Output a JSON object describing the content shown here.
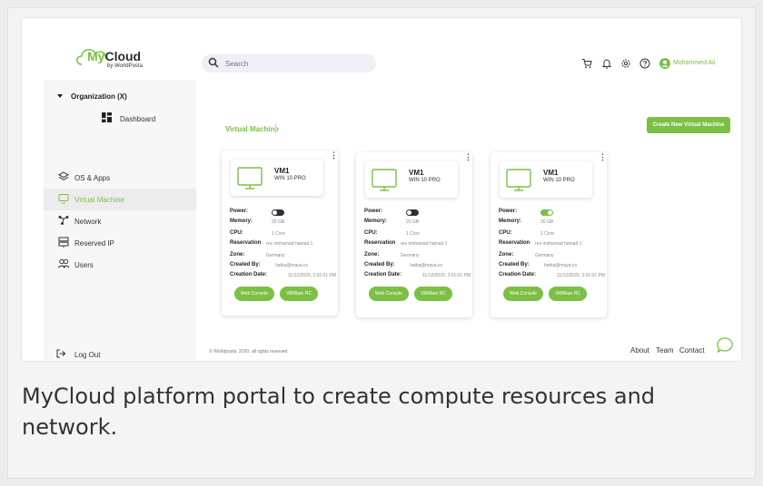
{
  "app": {
    "logo_my": "My",
    "logo_cloud": "Cloud",
    "logo_sub": "by WorldPosta"
  },
  "search": {
    "placeholder": "Search"
  },
  "header": {
    "user_name": "Mohammed Ali",
    "icons": [
      "cart-icon",
      "bell-icon",
      "gear-icon",
      "help-icon",
      "user-icon"
    ]
  },
  "sidebar": {
    "org": "Organization (X)",
    "dashboard": "Dashboard",
    "items": [
      {
        "label": "OS & Apps",
        "icon": "layers-icon"
      },
      {
        "label": "Virtual Machine",
        "icon": "monitor-icon",
        "active": true
      },
      {
        "label": "Network",
        "icon": "network-icon"
      },
      {
        "label": "Reserved IP",
        "icon": "server-icon"
      },
      {
        "label": "Users",
        "icon": "users-icon"
      }
    ],
    "logout": "Log Out"
  },
  "main": {
    "title": "Virtual Machine",
    "create_button": "Create New Virtual Machine",
    "field_labels": [
      "Power:",
      "Memory:",
      "CPU:",
      "Reservation",
      "Zone:",
      "Created By:",
      "Creation Date:"
    ],
    "button_labels": {
      "web_console": "Web Console",
      "vmware_rc": "VMWare RC"
    },
    "vms": [
      {
        "name": "VM1",
        "os": "WIN 10 PRO",
        "power_on": false,
        "memory": "20 GB",
        "cpu": "1 Core",
        "reservation": "res mohamad hamad 1",
        "zone": "Germany",
        "created_by": "hattia@maya.co",
        "creation_date": "11/12/2020, 2:01:01 PM"
      },
      {
        "name": "VM1",
        "os": "WIN 10 PRO",
        "power_on": false,
        "memory": "20 GB",
        "cpu": "1 Core",
        "reservation": "res mohamad hamad 1",
        "zone": "Germany",
        "created_by": "hattia@maya.co",
        "creation_date": "11/12/2020, 2:01:01 PM"
      },
      {
        "name": "VM1",
        "os": "WIN 10 PRO",
        "power_on": true,
        "memory": "20 GB",
        "cpu": "1 Core",
        "reservation": "res mohamad hamad 1",
        "zone": "Germany",
        "created_by": "hattia@maya.co",
        "creation_date": "11/12/2020, 2:01:01 PM"
      }
    ]
  },
  "footer": {
    "copyright": "© Worldposta. 2020. all rights reserved",
    "links": [
      "About",
      "Team",
      "Contact"
    ]
  },
  "caption": "MyCloud platform portal to create compute resources and network.",
  "colors": {
    "accent": "#7bc043",
    "toggle_off": "#2f2f3a",
    "sidebar_bg": "#f7f7f7"
  }
}
